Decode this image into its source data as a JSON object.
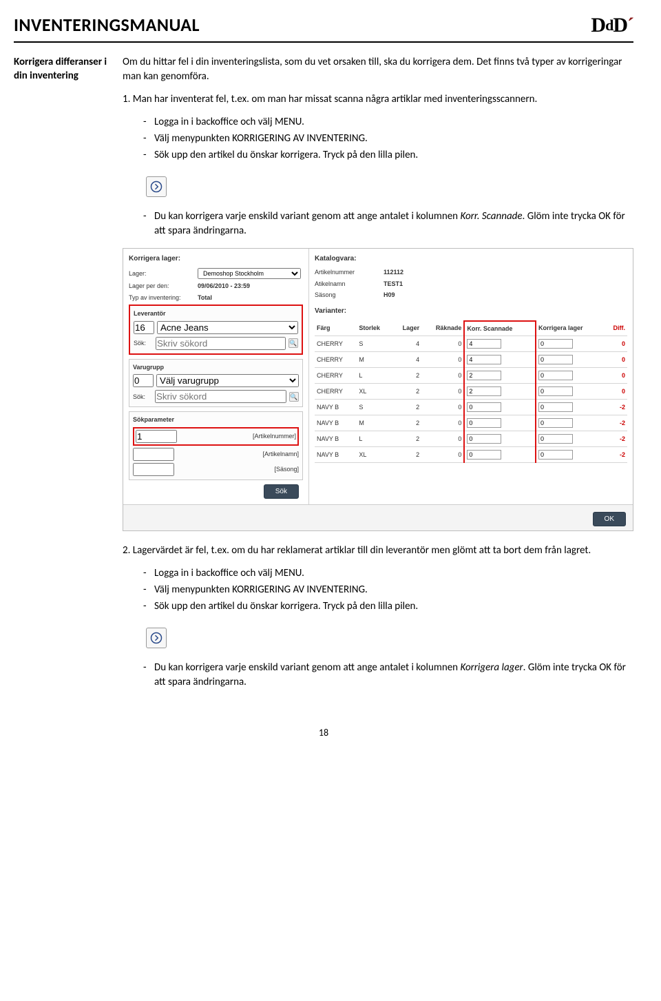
{
  "header": {
    "title": "INVENTERINGSMANUAL",
    "logo_main": "D",
    "logo_small": "d",
    "logo_accent": "´"
  },
  "side": {
    "heading": "Korrigera differanser i din inventering"
  },
  "body": {
    "intro": "Om du hittar fel i din inventeringslista, som du vet orsaken till, ska du korrigera dem. Det finns två typer av korrigeringar man kan genomföra.",
    "case1_lead": "1. Man har inventerat fel, t.ex. om man har missat scanna några artiklar med inventeringsscannern.",
    "steps_a": [
      "Logga in i backoffice och välj MENU.",
      "Välj menypunkten KORRIGERING AV INVENTERING.",
      "Sök upp den artikel du önskar korrigera. Tryck på den lilla pilen."
    ],
    "note1_a": "Du kan korrigera varje enskild variant genom att ange antalet i kolumnen ",
    "note1_em": "Korr. Scannade",
    "note1_b": ". Glöm inte trycka OK för att spara ändringarna.",
    "case2_lead": "2. Lagervärdet är fel, t.ex. om du har reklamerat artiklar till din leverantör men glömt att ta bort dem från lagret.",
    "steps_b": [
      "Logga in i backoffice och välj MENU.",
      "Välj menypunkten KORRIGERING AV INVENTERING.",
      "Sök upp den artikel du önskar korrigera. Tryck på den lilla pilen."
    ],
    "note2_a": "Du kan korrigera varje enskild variant genom att ange antalet i kolumnen ",
    "note2_em": "Korrigera lager",
    "note2_b": ". Glöm inte trycka OK för att spara ändringarna."
  },
  "shot": {
    "left_title": "Korrigera lager:",
    "right_title": "Katalogvara:",
    "lager_label": "Lager:",
    "lager_value": "Demoshop Stockholm",
    "lagerper_label": "Lager per den:",
    "lagerper_value": "09/06/2010 - 23:59",
    "typ_label": "Typ av inventering:",
    "typ_value": "Total",
    "lev_title": "Leverantör",
    "lev_code": "16",
    "lev_name": "Acne Jeans",
    "sok_label": "Sök:",
    "sok_ph": "Skriv sökord",
    "vg_title": "Varugrupp",
    "vg_code": "0",
    "vg_name": "Välj varugrupp",
    "sp_title": "Sökparameter",
    "sp_art_val": "1",
    "sp_art_ph": "[Artikelnummer]",
    "sp_name_ph": "[Artikelnamn]",
    "sp_season_ph": "[Säsong]",
    "sok_btn": "Sök",
    "ok_btn": "OK",
    "kv_artnr_l": "Artikelnummer",
    "kv_artnr_v": "112112",
    "kv_artnamn_l": "Atikelnamn",
    "kv_artnamn_v": "TEST1",
    "kv_sasong_l": "Säsong",
    "kv_sasong_v": "H09",
    "var_title": "Varianter:",
    "cols": {
      "farg": "Färg",
      "storlek": "Storlek",
      "lager": "Lager",
      "raknade": "Räknade",
      "korr": "Korr. Scannade",
      "korrlager": "Korrigera lager",
      "diff": "Diff."
    },
    "rows": [
      {
        "farg": "CHERRY",
        "storlek": "S",
        "lager": "4",
        "raknade": "0",
        "korr": "4",
        "korrlager": "0",
        "diff": "0"
      },
      {
        "farg": "CHERRY",
        "storlek": "M",
        "lager": "4",
        "raknade": "0",
        "korr": "4",
        "korrlager": "0",
        "diff": "0"
      },
      {
        "farg": "CHERRY",
        "storlek": "L",
        "lager": "2",
        "raknade": "0",
        "korr": "2",
        "korrlager": "0",
        "diff": "0"
      },
      {
        "farg": "CHERRY",
        "storlek": "XL",
        "lager": "2",
        "raknade": "0",
        "korr": "2",
        "korrlager": "0",
        "diff": "0"
      },
      {
        "farg": "NAVY B",
        "storlek": "S",
        "lager": "2",
        "raknade": "0",
        "korr": "0",
        "korrlager": "0",
        "diff": "-2"
      },
      {
        "farg": "NAVY B",
        "storlek": "M",
        "lager": "2",
        "raknade": "0",
        "korr": "0",
        "korrlager": "0",
        "diff": "-2"
      },
      {
        "farg": "NAVY B",
        "storlek": "L",
        "lager": "2",
        "raknade": "0",
        "korr": "0",
        "korrlager": "0",
        "diff": "-2"
      },
      {
        "farg": "NAVY B",
        "storlek": "XL",
        "lager": "2",
        "raknade": "0",
        "korr": "0",
        "korrlager": "0",
        "diff": "-2"
      }
    ]
  },
  "pagenum": "18"
}
